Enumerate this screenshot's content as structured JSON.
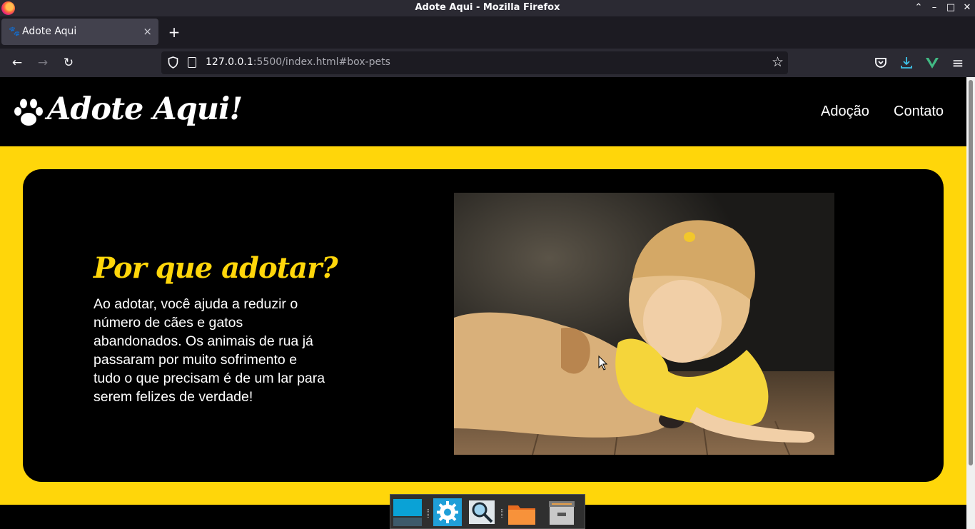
{
  "window": {
    "title": "Adote Aqui - Mozilla Firefox",
    "controls": {
      "minimize": "–",
      "maximize": "□",
      "close": "✕",
      "restore": "⌃"
    }
  },
  "tab": {
    "favicon": "🐾",
    "title": "Adote Aqui",
    "close": "×",
    "new_tab": "+"
  },
  "navbar": {
    "back": "←",
    "forward": "→",
    "reload": "↻",
    "url_host": "127.0.0.1",
    "url_rest": ":5500/index.html#box-pets",
    "bookmark_star": "☆",
    "pocket_icon": "pocket-icon",
    "download_icon": "download-icon",
    "vue_icon": "vue-devtools-icon",
    "menu": "≡"
  },
  "site": {
    "logo_text": "Adote Aqui!",
    "nav": [
      "Adoção",
      "Contato"
    ]
  },
  "hero": {
    "title": "Por que adotar?",
    "text": "Ao adotar, você ajuda a reduzir o número de cães e gatos abandonados. Os animais de rua já passaram por muito sofrimento e tudo o que precisam é de um lar para serem felizes de verdade!",
    "photo_description_icon": "child-kissing-dog-photo"
  },
  "colors": {
    "accent": "#ffd60a",
    "background": "#000000",
    "text": "#ffffff"
  },
  "dock": {
    "items": [
      "window-switcher-icon",
      "settings-icon",
      "search-icon",
      "files-icon",
      "archive-icon"
    ]
  }
}
